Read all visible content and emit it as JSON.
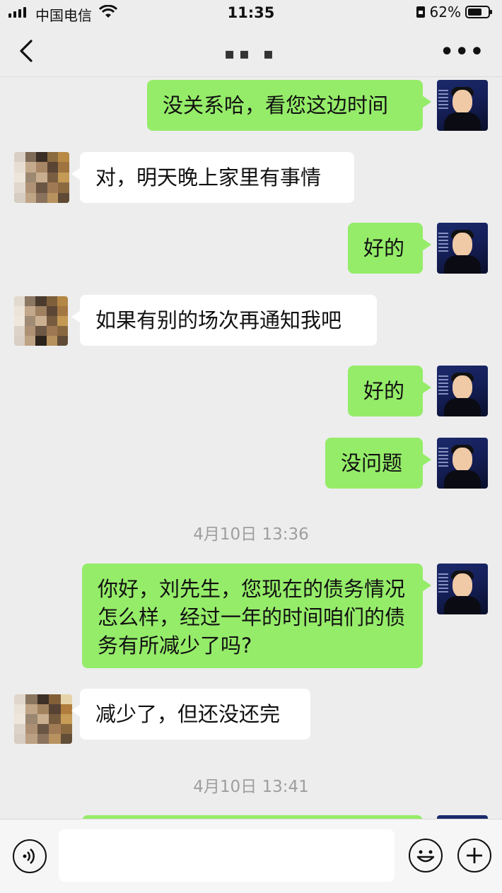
{
  "status_bar": {
    "carrier": "中国电信",
    "time": "11:35",
    "battery": "62%"
  },
  "nav": {
    "title": "▪▪ ▪"
  },
  "messages": [
    {
      "side": "me",
      "text": "没关系哈，看您这边时间"
    },
    {
      "side": "them",
      "text": "对，明天晚上家里有事情"
    },
    {
      "side": "me",
      "text": "好的"
    },
    {
      "side": "them",
      "text": "如果有别的场次再通知我吧"
    },
    {
      "side": "me",
      "text": "好的"
    },
    {
      "side": "me",
      "text": "没问题"
    },
    {
      "side": "me",
      "text": "你好，刘先生，您现在的债务情况怎么样，经过一年的时间咱们的债务有所减少了吗?"
    },
    {
      "side": "them",
      "text": "减少了，但还没还完"
    }
  ],
  "timestamps": [
    "4月10日 13:36",
    "4月10日 13:41"
  ],
  "icons": {
    "back": "chevron-left-icon",
    "more": "more-icon",
    "voice": "voice-icon",
    "emoji": "emoji-icon",
    "plus": "plus-icon"
  },
  "colors": {
    "my_bubble": "#95ec69",
    "their_bubble": "#ffffff",
    "background": "#ededed"
  }
}
